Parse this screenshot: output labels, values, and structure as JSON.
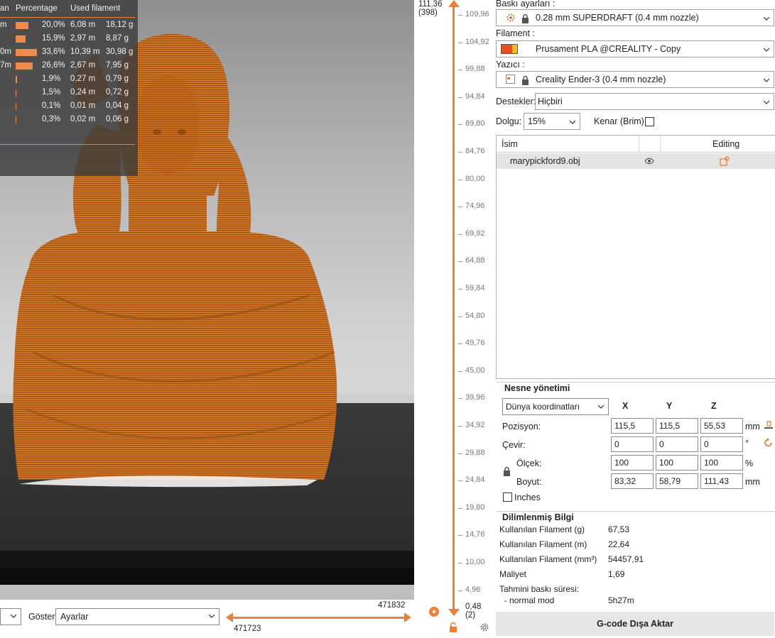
{
  "legend": {
    "headers": [
      "an",
      "Percentage",
      "Used filament"
    ],
    "rows": [
      {
        "name": "m",
        "bar_fraction": 0.2,
        "percent": "20,0%",
        "length": "6,08 m",
        "weight": "18,12 g"
      },
      {
        "name": "",
        "bar_fraction": 0.159,
        "percent": "15,9%",
        "length": "2,97 m",
        "weight": "8,87 g"
      },
      {
        "name": "0m",
        "bar_fraction": 0.336,
        "percent": "33,6%",
        "length": "10,39 m",
        "weight": "30,98 g"
      },
      {
        "name": "7m",
        "bar_fraction": 0.266,
        "percent": "26,6%",
        "length": "2,67 m",
        "weight": "7,95 g"
      },
      {
        "name": "",
        "bar_fraction": 0.019,
        "percent": "1,9%",
        "length": "0,27 m",
        "weight": "0,79 g"
      },
      {
        "name": "",
        "bar_fraction": 0.015,
        "percent": "1,5%",
        "length": "0,24 m",
        "weight": "0,72 g"
      },
      {
        "name": "",
        "bar_fraction": 0.001,
        "percent": "0,1%",
        "length": "0,01 m",
        "weight": "0,04 g"
      },
      {
        "name": "",
        "bar_fraction": 0.003,
        "percent": "0,3%",
        "length": "0,02 m",
        "weight": "0,06 g"
      }
    ]
  },
  "layer_slider": {
    "top_height": "111,36",
    "top_layer": "(398)",
    "bottom_height": "0,48",
    "bottom_layer": "(2)",
    "ticks": [
      "109,96",
      "104,92",
      "99,88",
      "94,84",
      "89,80",
      "84,76",
      "80,00",
      "74,96",
      "69,92",
      "64,88",
      "59,84",
      "54,80",
      "49,76",
      "45,00",
      "39,96",
      "34,92",
      "29,88",
      "24,84",
      "19,80",
      "14,76",
      "10,00",
      "4,96"
    ]
  },
  "bottombar": {
    "goster_label": "Göster",
    "goster_value": "Ayarlar",
    "move_max": "471832",
    "move_min": "471723"
  },
  "panel": {
    "print_settings_label": "Baskı ayarları :",
    "print_settings_value": "0.28 mm SUPERDRAFT (0.4 mm nozzle)",
    "filament_label": "Filament :",
    "filament_value": "Prusament PLA @CREALITY - Copy",
    "printer_label": "Yazıcı :",
    "printer_value": "Creality Ender-3 (0.4 mm nozzle)",
    "supports_label": "Destekler:",
    "supports_value": "Hiçbiri",
    "infill_label": "Dolgu:",
    "infill_value": "15%",
    "brim_label": "Kenar (Brim):",
    "colors": {
      "accent": "#ee7f3a",
      "filament_swatch_a": "#e8501f",
      "filament_swatch_b": "#f2c01a"
    }
  },
  "object_list": {
    "col_name": "İsim",
    "col_editing": "Editing",
    "items": [
      {
        "name": "marypickford9.obj"
      }
    ]
  },
  "object_manip": {
    "title": "Nesne yönetimi",
    "coord_system": "Dünya koordinatları",
    "axes": [
      "X",
      "Y",
      "Z"
    ],
    "position_label": "Pozisyon:",
    "position": [
      "115,5",
      "115,5",
      "55,53"
    ],
    "position_unit": "mm",
    "rotation_label": "Çevir:",
    "rotation": [
      "0",
      "0",
      "0"
    ],
    "rotation_unit": "°",
    "scale_label": "Ölçek:",
    "scale": [
      "100",
      "100",
      "100"
    ],
    "scale_unit": "%",
    "size_label": "Boyut:",
    "size": [
      "83,32",
      "58,79",
      "111,43"
    ],
    "size_unit": "mm",
    "inches_label": "Inches"
  },
  "sliced_info": {
    "title": "Dilimlenmiş Bilgi",
    "rows": [
      {
        "label": "Kullanılan Filament (g)",
        "value": "67,53"
      },
      {
        "label": "Kullanılan Filament (m)",
        "value": "22,64"
      },
      {
        "label": "Kullanılan Filament (mm³)",
        "value": "54457,91"
      },
      {
        "label": "Maliyet",
        "value": "1,69"
      },
      {
        "label": "Tahmini baskı süresi:",
        "value": ""
      },
      {
        "label": "  - normal mod",
        "value": "5h27m"
      }
    ]
  },
  "export_button": "G-code Dışa Aktar"
}
